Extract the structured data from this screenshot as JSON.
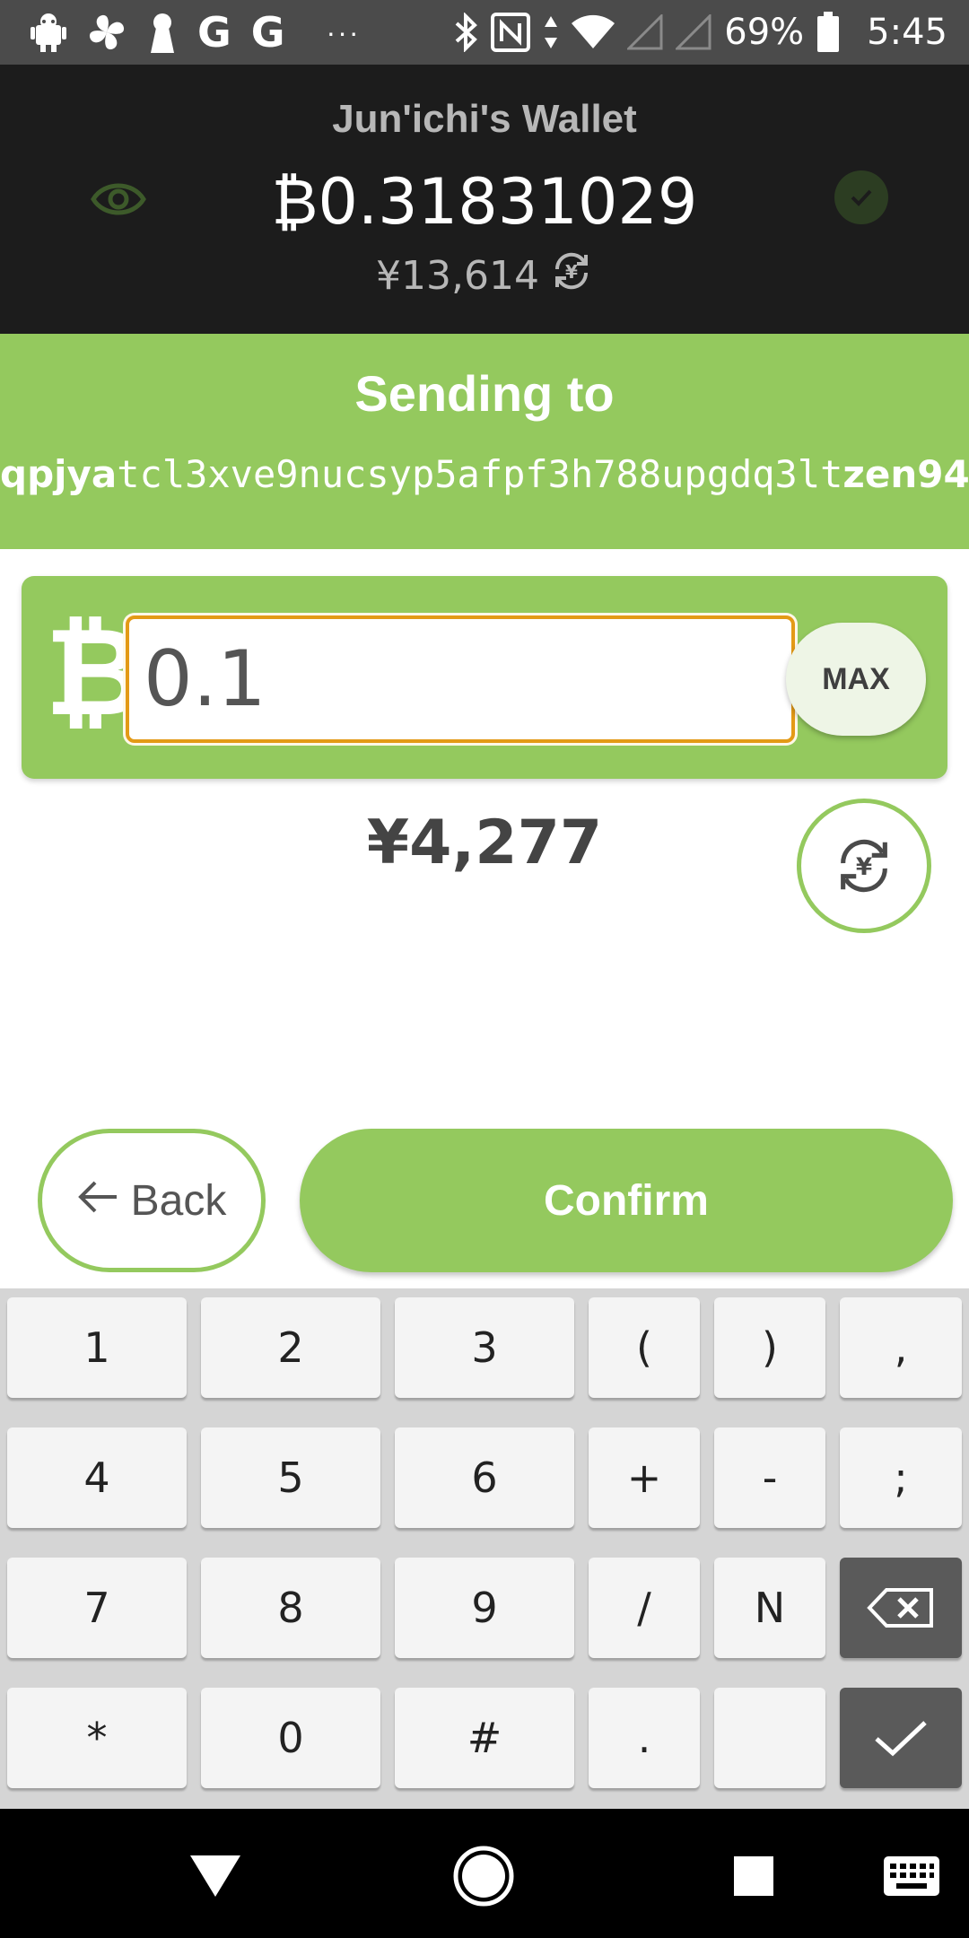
{
  "status_bar": {
    "g_letter_1": "G",
    "g_letter_2": "G",
    "overflow": "···",
    "battery": "69%",
    "time": "5:45"
  },
  "header": {
    "wallet_name": "Jun'ichi's Wallet",
    "balance": "₿0.31831029",
    "fiat_balance": "¥13,614"
  },
  "sending": {
    "title": "Sending to",
    "address_prefix": "qpjya",
    "address_middle": "tcl3xve9nucsyp5afpf3h788upgdq3lt",
    "address_suffix": "zen94"
  },
  "amount": {
    "currency_symbol": "₿",
    "value": "0.1",
    "max_label": "MAX",
    "fiat_value": "¥4,277"
  },
  "actions": {
    "back_label": "Back",
    "confirm_label": "Confirm"
  },
  "keyboard": {
    "rows": [
      [
        "1",
        "2",
        "3",
        "(",
        ")",
        ","
      ],
      [
        "4",
        "5",
        "6",
        "+",
        "-",
        ";"
      ],
      [
        "7",
        "8",
        "9",
        "/",
        "N",
        ""
      ],
      [
        "*",
        "0",
        "#",
        ".",
        "",
        ""
      ]
    ]
  },
  "colors": {
    "accent_green": "#94c95e",
    "header_bg": "#1c1c1c",
    "input_border": "#e39a16"
  },
  "icons": {
    "eye": "eye-icon",
    "verified": "check-badge-icon",
    "currency_swap": "currency-swap-icon",
    "back_arrow": "arrow-left-icon",
    "backspace": "backspace-icon",
    "done": "checkmark-icon"
  }
}
